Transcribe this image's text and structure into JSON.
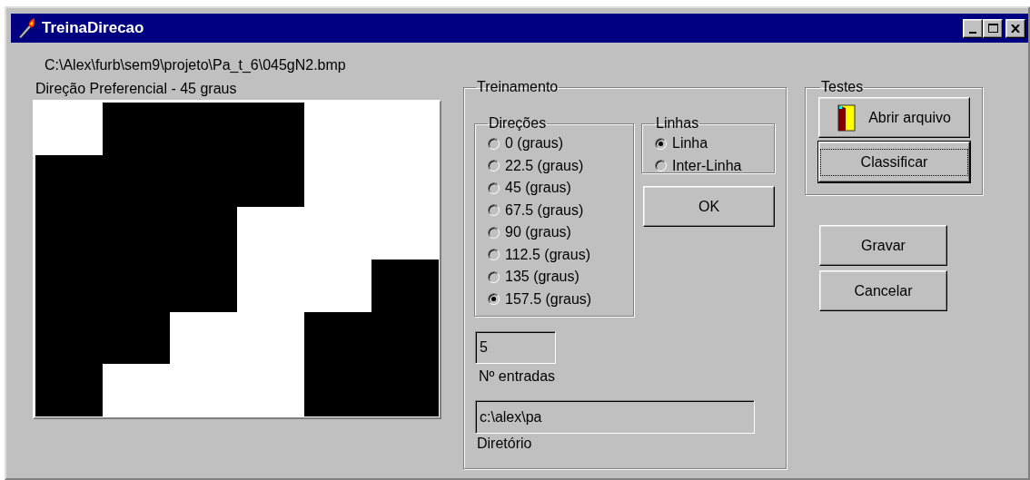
{
  "window": {
    "title": "TreinaDirecao"
  },
  "file_path": "C:\\Alex\\furb\\sem9\\projeto\\Pa_t_6\\045gN2.bmp",
  "image_caption": "Direção Preferencial - 45 graus",
  "treinamento": {
    "title": "Treinamento",
    "direcoes": {
      "title": "Direções",
      "options": [
        {
          "label": "0 (graus)",
          "selected": false
        },
        {
          "label": "22.5 (graus)",
          "selected": false
        },
        {
          "label": "45 (graus)",
          "selected": false
        },
        {
          "label": "67.5 (graus)",
          "selected": false
        },
        {
          "label": "90 (graus)",
          "selected": false
        },
        {
          "label": "112.5 (graus)",
          "selected": false
        },
        {
          "label": "135 (graus)",
          "selected": false
        },
        {
          "label": "157.5 (graus)",
          "selected": true
        }
      ]
    },
    "linhas": {
      "title": "Linhas",
      "options": [
        {
          "label": "Linha",
          "selected": true
        },
        {
          "label": "Inter-Linha",
          "selected": false
        }
      ]
    },
    "ok_button": "OK",
    "entries": {
      "value": "5",
      "label": "Nº entradas"
    },
    "directory": {
      "value": "c:\\alex\\pa",
      "label": "Diretório"
    }
  },
  "testes": {
    "title": "Testes",
    "buttons": [
      {
        "label": "Abrir arquivo",
        "kind": "icon",
        "focused": false
      },
      {
        "label": "Classificar",
        "kind": "plain",
        "focused": true
      }
    ]
  },
  "actions": [
    "Gravar",
    "Cancelar"
  ]
}
